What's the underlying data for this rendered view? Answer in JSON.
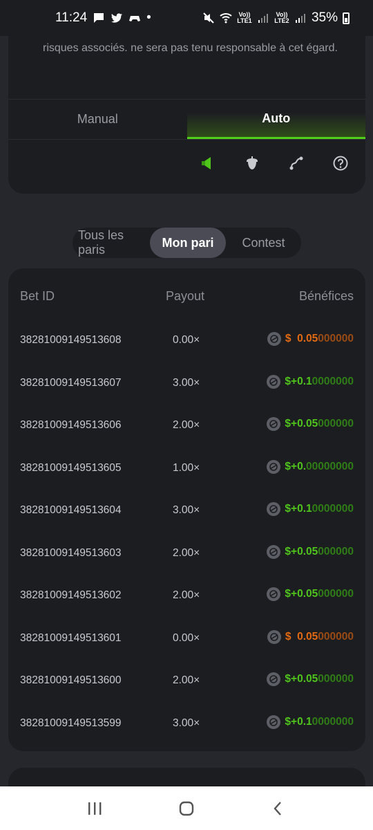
{
  "status": {
    "time": "11:24",
    "network1": "Vo)) LTE1",
    "network2": "Vo)) LTE2",
    "battery": "35%"
  },
  "disclaimer": "risques associés. ne sera pas tenu responsable à cet égard.",
  "mode_tabs": {
    "manual": "Manual",
    "auto": "Auto"
  },
  "toolbar_icons": [
    "sound-icon",
    "acorn-icon",
    "curve-icon",
    "help-icon"
  ],
  "bet_tabs": {
    "all": "Tous les paris",
    "mine": "Mon pari",
    "contest": "Contest"
  },
  "bets_table": {
    "columns": [
      "Bet ID",
      "Payout",
      "Bénéfices"
    ],
    "rows": [
      {
        "id": "38281009149513608",
        "payout": "0.00×",
        "sign": "$  ",
        "strong": "0.05",
        "dim": "000000",
        "result": "loss"
      },
      {
        "id": "38281009149513607",
        "payout": "3.00×",
        "sign": "$+",
        "strong": "0.1",
        "dim": "0000000",
        "result": "win"
      },
      {
        "id": "38281009149513606",
        "payout": "2.00×",
        "sign": "$+",
        "strong": "0.05",
        "dim": "000000",
        "result": "win"
      },
      {
        "id": "38281009149513605",
        "payout": "1.00×",
        "sign": "$+",
        "strong": "0.",
        "dim": "00000000",
        "result": "win"
      },
      {
        "id": "38281009149513604",
        "payout": "3.00×",
        "sign": "$+",
        "strong": "0.1",
        "dim": "0000000",
        "result": "win"
      },
      {
        "id": "38281009149513603",
        "payout": "2.00×",
        "sign": "$+",
        "strong": "0.05",
        "dim": "000000",
        "result": "win"
      },
      {
        "id": "38281009149513602",
        "payout": "2.00×",
        "sign": "$+",
        "strong": "0.05",
        "dim": "000000",
        "result": "win"
      },
      {
        "id": "38281009149513601",
        "payout": "0.00×",
        "sign": "$  ",
        "strong": "0.05",
        "dim": "000000",
        "result": "loss"
      },
      {
        "id": "38281009149513600",
        "payout": "2.00×",
        "sign": "$+",
        "strong": "0.05",
        "dim": "000000",
        "result": "win"
      },
      {
        "id": "38281009149513599",
        "payout": "3.00×",
        "sign": "$+",
        "strong": "0.1",
        "dim": "0000000",
        "result": "win"
      }
    ]
  },
  "colors": {
    "accent_green": "#4fd01b",
    "loss_orange": "#e36a12",
    "card_bg": "#1c1d21",
    "page_bg": "#26272c"
  }
}
